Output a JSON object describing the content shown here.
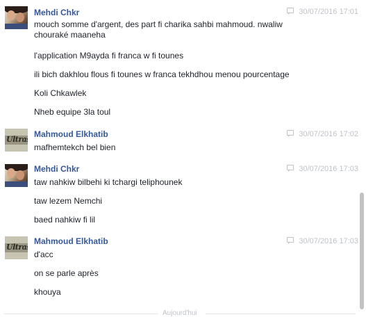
{
  "messages": [
    {
      "sender": "Mehdi Chkr",
      "avatar": "selfie",
      "timestamp": "30/07/2016 17:01",
      "lines": [
        "mouch somme d'argent, des part fi charika sahbi mahmoud. nwaliw chouraké maaneha",
        "l'application M9ayda fi franca w fi tounes",
        "ili bich dakhlou flous fi tounes w franca tekhdhou menou pourcentage",
        "Koli Chkawlek",
        "Nheb equipe 3la toul"
      ]
    },
    {
      "sender": "Mahmoud Elkhatib",
      "avatar": "ultras",
      "timestamp": "30/07/2016 17:02",
      "lines": [
        "mafhemtekch bel bien"
      ]
    },
    {
      "sender": "Mehdi Chkr",
      "avatar": "selfie",
      "timestamp": "30/07/2016 17:03",
      "lines": [
        "taw nahkiw bilbehi ki tchargi teliphounek",
        "taw lezem Nemchi",
        "baed nahkiw fi lil"
      ]
    },
    {
      "sender": "Mahmoud Elkhatib",
      "avatar": "ultras",
      "timestamp": "30/07/2016 17:03",
      "lines": [
        "d'acc",
        "on se parle après",
        "khouya"
      ]
    }
  ],
  "avatar_text": "Ultras",
  "divider_label": "Aujourd'hui",
  "colors": {
    "name": "#365899",
    "timestamp": "#bec3c9",
    "text": "#1d2129"
  }
}
